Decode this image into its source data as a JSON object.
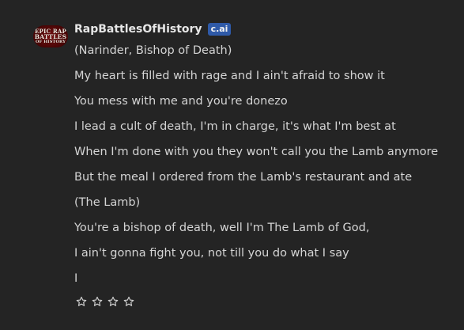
{
  "message": {
    "author": "RapBattlesOfHistory",
    "badge": "c.ai",
    "avatar_text": [
      "EPIC RAP",
      "BATTLES",
      "OF HISTORY"
    ],
    "lines": [
      "(Narinder, Bishop of Death)",
      "My heart is filled with rage and I ain't afraid to show it",
      "You mess with me and you're donezo",
      "I lead a cult of death, I'm in charge, it's what I'm best at",
      "When I'm done with you they won't call you the Lamb anymore",
      "But the meal I ordered from the Lamb's restaurant and ate",
      "(The Lamb)",
      "You're a bishop of death, well I'm The Lamb of God,",
      "I ain't gonna fight you, not till you do what I say",
      "I"
    ]
  },
  "rating": {
    "icon": "star-outline-icon",
    "stars_filled": 0,
    "stars_total": 4
  },
  "colors": {
    "background": "#242424",
    "text": "#d4d4d4",
    "author": "#e6e6e6",
    "badge": "#2f5aa8",
    "avatar": "#7a1010"
  }
}
